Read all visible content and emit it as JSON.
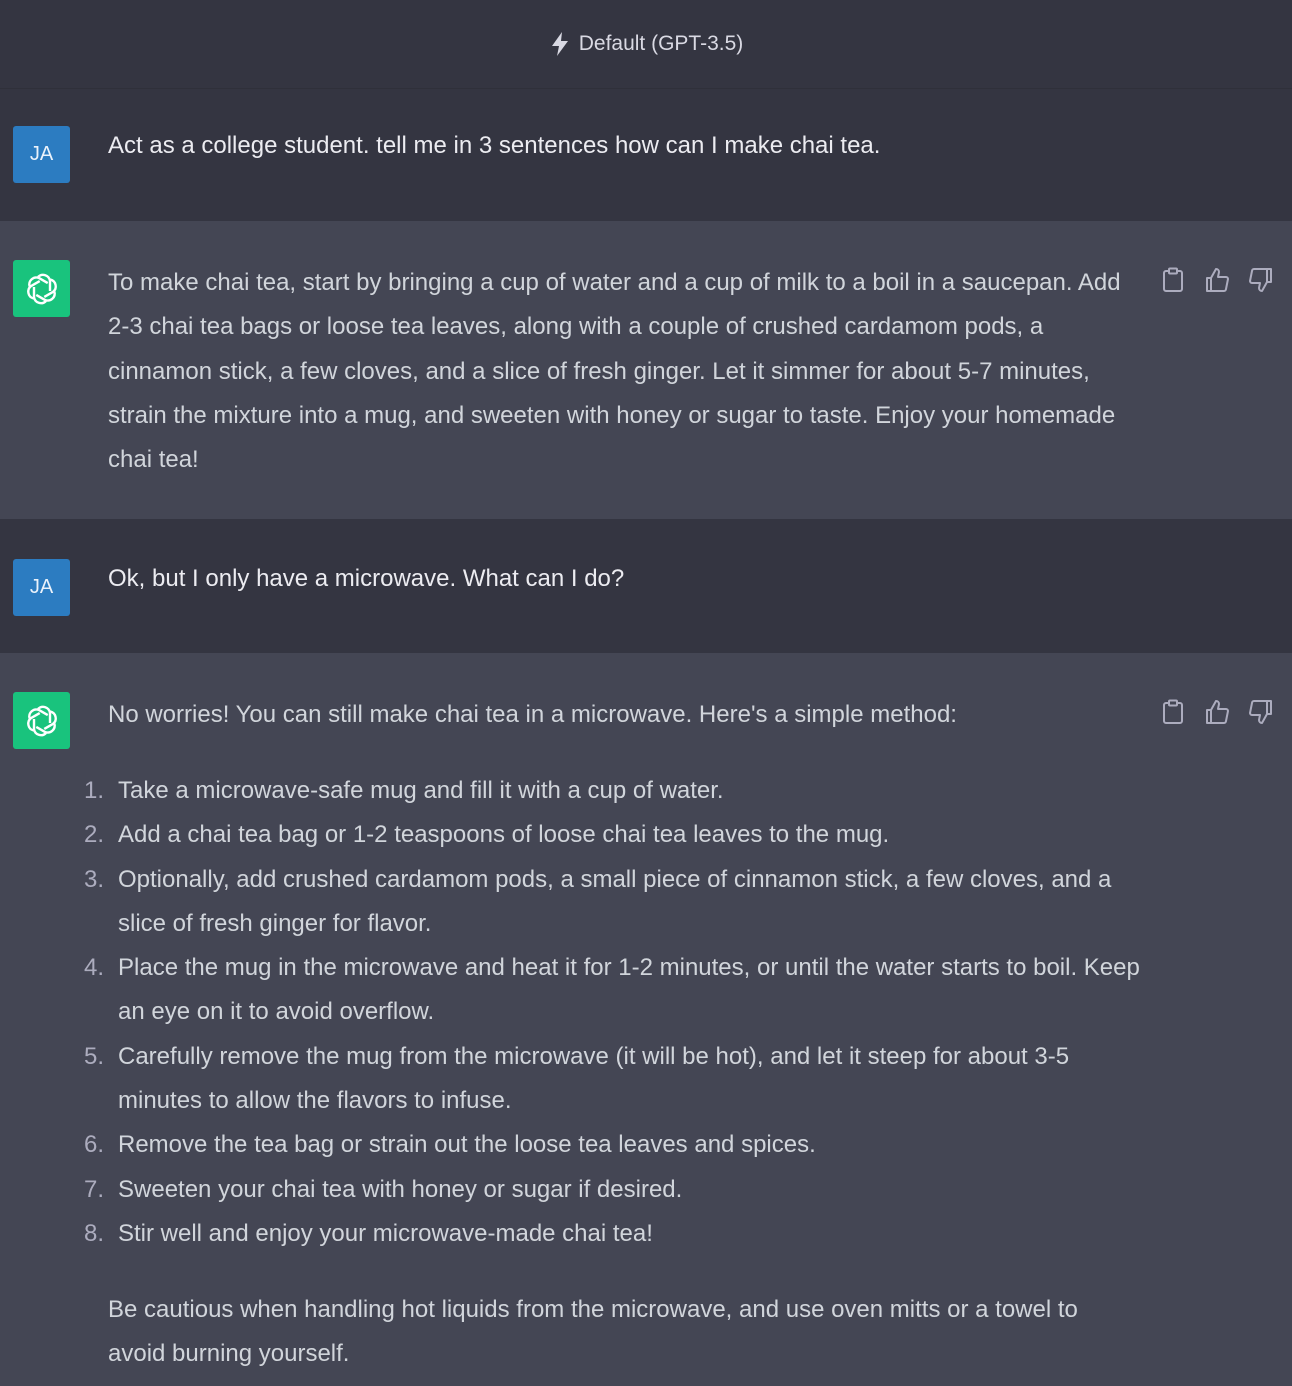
{
  "header": {
    "model_label": "Default (GPT-3.5)"
  },
  "messages": [
    {
      "role": "user",
      "avatar": "JA",
      "text": "Act as a college student. tell me in 3 sentences how can I make chai tea."
    },
    {
      "role": "assistant",
      "text": "To make chai tea, start by bringing a cup of water and a cup of milk to a boil in a saucepan. Add 2-3 chai tea bags or loose tea leaves, along with a couple of crushed cardamom pods, a cinnamon stick, a few cloves, and a slice of fresh ginger. Let it simmer for about 5-7 minutes, strain the mixture into a mug, and sweeten with honey or sugar to taste. Enjoy your homemade chai tea!"
    },
    {
      "role": "user",
      "avatar": "JA",
      "text": "Ok, but I only have a microwave. What can I do?"
    },
    {
      "role": "assistant",
      "intro": "No worries! You can still make chai tea in a microwave. Here's a simple method:",
      "steps": [
        {
          "num": "1.",
          "text": "Take a microwave-safe mug and fill it with a cup of water."
        },
        {
          "num": "2.",
          "text": "Add a chai tea bag or 1-2 teaspoons of loose chai tea leaves to the mug."
        },
        {
          "num": "3.",
          "text": "Optionally, add crushed cardamom pods, a small piece of cinnamon stick, a few cloves, and a slice of fresh ginger for flavor."
        },
        {
          "num": "4.",
          "text": "Place the mug in the microwave and heat it for 1-2 minutes, or until the water starts to boil. Keep an eye on it to avoid overflow."
        },
        {
          "num": "5.",
          "text": "Carefully remove the mug from the microwave (it will be hot), and let it steep for about 3-5 minutes to allow the flavors to infuse."
        },
        {
          "num": "6.",
          "text": "Remove the tea bag or strain out the loose tea leaves and spices."
        },
        {
          "num": "7.",
          "text": "Sweeten your chai tea with honey or sugar if desired."
        },
        {
          "num": "8.",
          "text": "Stir well and enjoy your microwave-made chai tea!"
        }
      ],
      "outro": "Be cautious when handling hot liquids from the microwave, and use oven mitts or a towel to avoid burning yourself."
    }
  ],
  "icons": {
    "model": "lightning-icon",
    "copy": "clipboard-icon",
    "like": "thumbs-up-icon",
    "dislike": "thumbs-down-icon",
    "assistant": "openai-logo-icon"
  },
  "colors": {
    "user_bg": "#343541",
    "assistant_bg": "#444654",
    "user_avatar": "#2c7cc1",
    "assistant_avatar": "#19c37d"
  }
}
